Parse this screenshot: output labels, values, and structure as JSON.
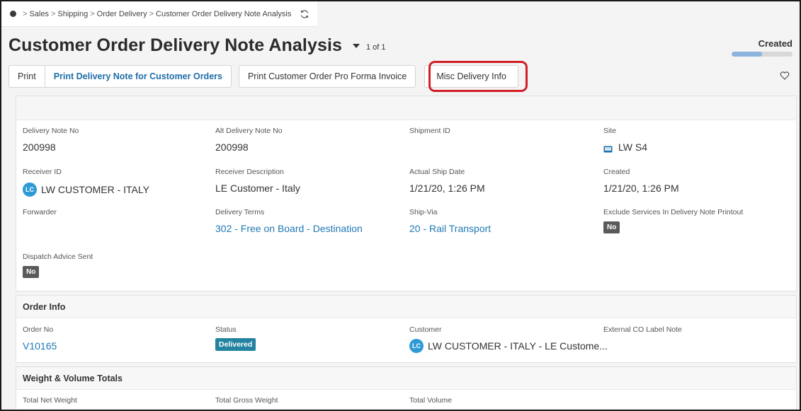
{
  "breadcrumb": {
    "items": [
      "Sales",
      "Shipping",
      "Order Delivery",
      "Customer Order Delivery Note Analysis"
    ],
    "separator": ">"
  },
  "header": {
    "title": "Customer Order Delivery Note Analysis",
    "record_count": "1 of 1",
    "state": "Created",
    "state_progress": 0.5
  },
  "toolbar": {
    "print": "Print",
    "print_delivery_note": "Print Delivery Note for Customer Orders",
    "print_pro_forma": "Print Customer Order Pro Forma Invoice",
    "misc_delivery_info": "Misc Delivery Info"
  },
  "main": {
    "delivery_note_no": {
      "label": "Delivery Note No",
      "value": "200998"
    },
    "alt_delivery_note_no": {
      "label": "Alt Delivery Note No",
      "value": "200998"
    },
    "shipment_id": {
      "label": "Shipment ID",
      "value": ""
    },
    "site": {
      "label": "Site",
      "value": "LW S4"
    },
    "receiver_id": {
      "label": "Receiver ID",
      "value": "LW CUSTOMER - ITALY",
      "avatar": "LC"
    },
    "receiver_description": {
      "label": "Receiver Description",
      "value": "LE Customer - Italy"
    },
    "actual_ship_date": {
      "label": "Actual Ship Date",
      "value": "1/21/20, 1:26 PM"
    },
    "created": {
      "label": "Created",
      "value": "1/21/20, 1:26 PM"
    },
    "forwarder": {
      "label": "Forwarder",
      "value": ""
    },
    "delivery_terms": {
      "label": "Delivery Terms",
      "value": "302 - Free on Board - Destination"
    },
    "ship_via": {
      "label": "Ship-Via",
      "value": "20 - Rail Transport"
    },
    "exclude_services": {
      "label": "Exclude Services In Delivery Note Printout",
      "value": "No"
    },
    "dispatch_advice_sent": {
      "label": "Dispatch Advice Sent",
      "value": "No"
    }
  },
  "order_info": {
    "title": "Order Info",
    "order_no": {
      "label": "Order No",
      "value": "V10165"
    },
    "status": {
      "label": "Status",
      "value": "Delivered"
    },
    "customer": {
      "label": "Customer",
      "value": "LW CUSTOMER - ITALY - LE Custome...",
      "avatar": "LC"
    },
    "external_co_label_note": {
      "label": "External CO Label Note",
      "value": ""
    }
  },
  "weight_volume": {
    "title": "Weight & Volume Totals",
    "total_net_weight": {
      "label": "Total Net Weight"
    },
    "total_gross_weight": {
      "label": "Total Gross Weight"
    },
    "total_volume": {
      "label": "Total Volume"
    }
  },
  "colors": {
    "link": "#1f78b4",
    "highlight": "#d21f27",
    "status_badge": "#2483a0",
    "avatar": "#2e9ad6"
  }
}
